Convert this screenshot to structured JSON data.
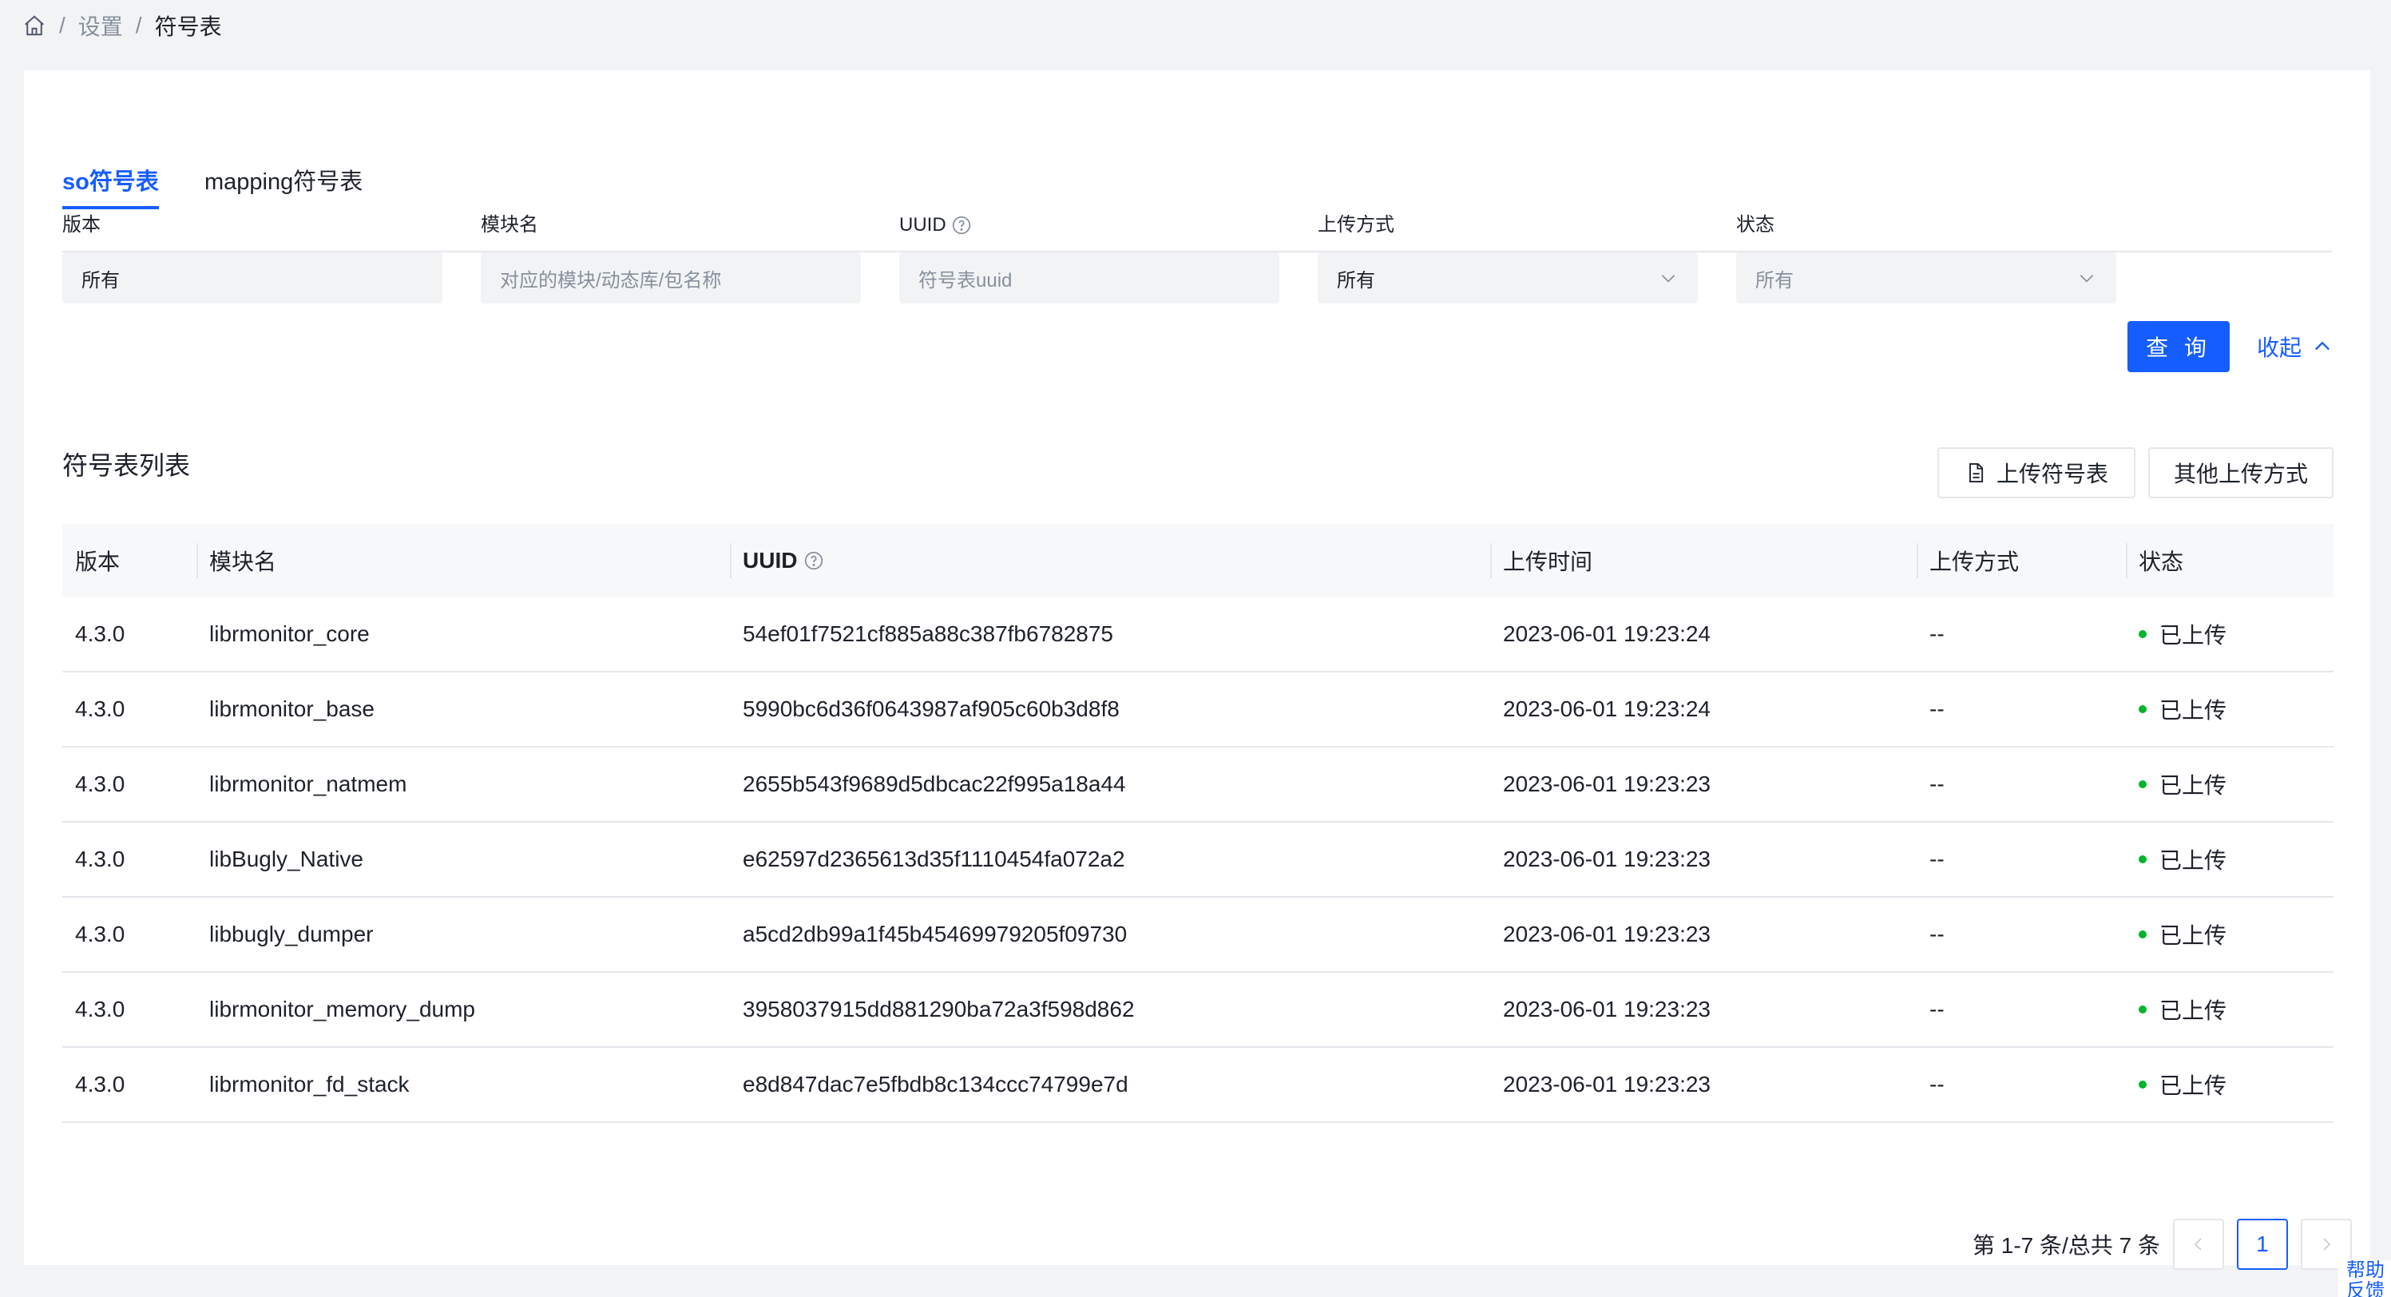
{
  "breadcrumb": {
    "home_icon": "home-icon",
    "sep": "/",
    "items": [
      "设置",
      "符号表"
    ]
  },
  "tabs": [
    {
      "label": "so符号表",
      "active": true
    },
    {
      "label": "mapping符号表",
      "active": false
    }
  ],
  "filters": {
    "version": {
      "label": "版本",
      "value": "所有"
    },
    "module": {
      "label": "模块名",
      "placeholder": "对应的模块/动态库/包名称"
    },
    "uuid": {
      "label": "UUID",
      "placeholder": "符号表uuid"
    },
    "upload_method": {
      "label": "上传方式",
      "value": "所有"
    },
    "status": {
      "label": "状态",
      "placeholder": "所有"
    }
  },
  "actions": {
    "query": "查 询",
    "collapse": "收起"
  },
  "list": {
    "title": "符号表列表",
    "upload_button": "上传符号表",
    "other_button": "其他上传方式",
    "columns": [
      "版本",
      "模块名",
      "UUID",
      "上传时间",
      "上传方式",
      "状态"
    ],
    "rows": [
      {
        "version": "4.3.0",
        "module": "librmonitor_core",
        "uuid": "54ef01f7521cf885a88c387fb6782875",
        "time": "2023-06-01 19:23:24",
        "method": "--",
        "status": "已上传"
      },
      {
        "version": "4.3.0",
        "module": "librmonitor_base",
        "uuid": "5990bc6d36f0643987af905c60b3d8f8",
        "time": "2023-06-01 19:23:24",
        "method": "--",
        "status": "已上传"
      },
      {
        "version": "4.3.0",
        "module": "librmonitor_natmem",
        "uuid": "2655b543f9689d5dbcac22f995a18a44",
        "time": "2023-06-01 19:23:23",
        "method": "--",
        "status": "已上传"
      },
      {
        "version": "4.3.0",
        "module": "libBugly_Native",
        "uuid": "e62597d2365613d35f1110454fa072a2",
        "time": "2023-06-01 19:23:23",
        "method": "--",
        "status": "已上传"
      },
      {
        "version": "4.3.0",
        "module": "libbugly_dumper",
        "uuid": "a5cd2db99a1f45b45469979205f09730",
        "time": "2023-06-01 19:23:23",
        "method": "--",
        "status": "已上传"
      },
      {
        "version": "4.3.0",
        "module": "librmonitor_memory_dump",
        "uuid": "3958037915dd881290ba72a3f598d862",
        "time": "2023-06-01 19:23:23",
        "method": "--",
        "status": "已上传"
      },
      {
        "version": "4.3.0",
        "module": "librmonitor_fd_stack",
        "uuid": "e8d847dac7e5fbdb8c134ccc74799e7d",
        "time": "2023-06-01 19:23:23",
        "method": "--",
        "status": "已上传"
      }
    ]
  },
  "pagination": {
    "info": "第 1-7 条/总共 7 条",
    "current": "1"
  },
  "help": "帮助反馈",
  "colors": {
    "accent": "#165dff",
    "success": "#00b42a"
  }
}
